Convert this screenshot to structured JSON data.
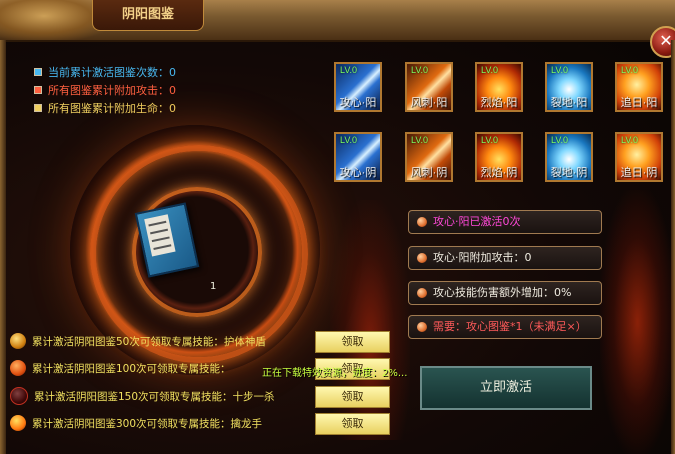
{
  "window": {
    "title": "阴阳图鉴",
    "close_label": "✕"
  },
  "stats": [
    {
      "text": "当前累计激活图鉴次数：0"
    },
    {
      "text": "所有图鉴累计附加攻击：0"
    },
    {
      "text": "所有图鉴累计附加生命：0"
    }
  ],
  "skills_row1": [
    {
      "lv": "LV.0",
      "name": "攻心·阳",
      "icon": "blue-blade-icon"
    },
    {
      "lv": "LV.0",
      "name": "风刺·阳",
      "icon": "orange-slash-icon"
    },
    {
      "lv": "LV.0",
      "name": "烈焰·阳",
      "icon": "fire-icon"
    },
    {
      "lv": "LV.0",
      "name": "裂地·阳",
      "icon": "ice-burst-icon"
    },
    {
      "lv": "LV.0",
      "name": "追日·阳",
      "icon": "sun-icon"
    }
  ],
  "skills_row2": [
    {
      "lv": "LV.0",
      "name": "攻心·阴",
      "icon": "blue-blade-icon"
    },
    {
      "lv": "LV.0",
      "name": "风刺·阴",
      "icon": "orange-slash-icon"
    },
    {
      "lv": "LV.0",
      "name": "烈焰·阴",
      "icon": "fire-icon"
    },
    {
      "lv": "LV.0",
      "name": "裂地·阴",
      "icon": "ice-burst-icon"
    },
    {
      "lv": "LV.0",
      "name": "追日·阴",
      "icon": "sun-icon"
    }
  ],
  "book": {
    "count": "1"
  },
  "info": {
    "activated": "攻心·阳已激活0次",
    "attack_bonus": "攻心·阳附加攻击：0",
    "damage_bonus": "攻心技能伤害额外增加：0%",
    "requirement": "需要：攻心图鉴*1（未满足×）"
  },
  "rewards": [
    {
      "text": "累计激活阴阳图鉴50次可领取专属技能：护体神盾",
      "button": "领取"
    },
    {
      "text": "累计激活阴阳图鉴100次可领取专属技能：",
      "button": "领取"
    },
    {
      "text": "累计激活阴阳图鉴150次可领取专属技能：十步一杀",
      "button": "领取"
    },
    {
      "text": "累计激活阴阳图鉴300次可领取专属技能：擒龙手",
      "button": "领取"
    }
  ],
  "loading_text": "正在下载特效资源，进度：2%...",
  "activate_label": "立即激活"
}
